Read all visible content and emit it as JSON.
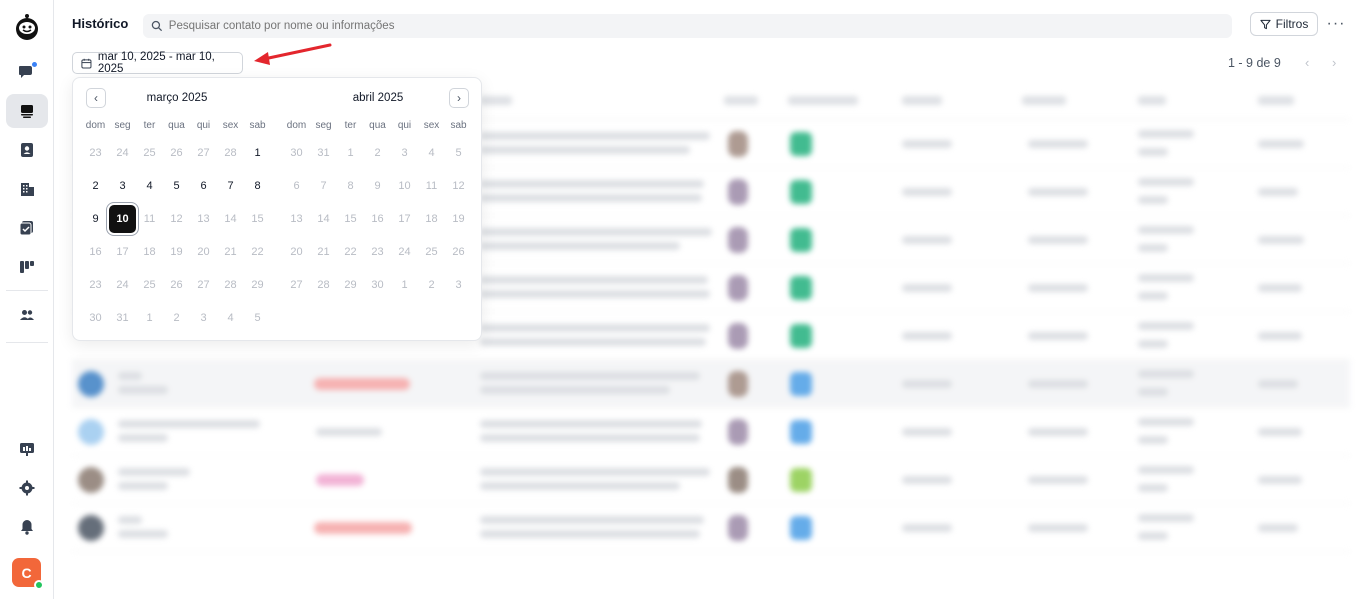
{
  "header": {
    "title": "Histórico",
    "search_placeholder": "Pesquisar contato por nome ou informações",
    "filters_label": "Filtros",
    "more_label": "···"
  },
  "date_range": {
    "label": "mar 10, 2025 - mar 10, 2025"
  },
  "pagination": {
    "text": "1 - 9 de 9",
    "prev": "‹",
    "next": "›"
  },
  "sidebar": {
    "avatar_initial": "C"
  },
  "calendar": {
    "prev": "‹",
    "next": "›",
    "weekdays": [
      "dom",
      "seg",
      "ter",
      "qua",
      "qui",
      "sex",
      "sab"
    ],
    "months": [
      {
        "title": "março 2025",
        "weeks": [
          [
            {
              "d": "23",
              "o": true
            },
            {
              "d": "24",
              "o": true
            },
            {
              "d": "25",
              "o": true
            },
            {
              "d": "26",
              "o": true
            },
            {
              "d": "27",
              "o": true
            },
            {
              "d": "28",
              "o": true
            },
            {
              "d": "1",
              "c": true
            }
          ],
          [
            {
              "d": "2",
              "c": true
            },
            {
              "d": "3",
              "c": true
            },
            {
              "d": "4",
              "c": true
            },
            {
              "d": "5",
              "c": true
            },
            {
              "d": "6",
              "c": true
            },
            {
              "d": "7",
              "c": true
            },
            {
              "d": "8",
              "c": true
            }
          ],
          [
            {
              "d": "9",
              "c": true
            },
            {
              "d": "10",
              "c": true,
              "s": true
            },
            {
              "d": "11"
            },
            {
              "d": "12"
            },
            {
              "d": "13"
            },
            {
              "d": "14"
            },
            {
              "d": "15"
            }
          ],
          [
            {
              "d": "16"
            },
            {
              "d": "17"
            },
            {
              "d": "18"
            },
            {
              "d": "19"
            },
            {
              "d": "20"
            },
            {
              "d": "21"
            },
            {
              "d": "22"
            }
          ],
          [
            {
              "d": "23"
            },
            {
              "d": "24"
            },
            {
              "d": "25"
            },
            {
              "d": "26"
            },
            {
              "d": "27"
            },
            {
              "d": "28"
            },
            {
              "d": "29"
            }
          ],
          [
            {
              "d": "30"
            },
            {
              "d": "31"
            },
            {
              "d": "1",
              "o": true
            },
            {
              "d": "2",
              "o": true
            },
            {
              "d": "3",
              "o": true
            },
            {
              "d": "4",
              "o": true
            },
            {
              "d": "5",
              "o": true
            }
          ]
        ]
      },
      {
        "title": "abril 2025",
        "weeks": [
          [
            {
              "d": "30",
              "o": true
            },
            {
              "d": "31",
              "o": true
            },
            {
              "d": "1"
            },
            {
              "d": "2"
            },
            {
              "d": "3"
            },
            {
              "d": "4"
            },
            {
              "d": "5"
            }
          ],
          [
            {
              "d": "6"
            },
            {
              "d": "7"
            },
            {
              "d": "8"
            },
            {
              "d": "9"
            },
            {
              "d": "10"
            },
            {
              "d": "11"
            },
            {
              "d": "12"
            }
          ],
          [
            {
              "d": "13"
            },
            {
              "d": "14"
            },
            {
              "d": "15"
            },
            {
              "d": "16"
            },
            {
              "d": "17"
            },
            {
              "d": "18"
            },
            {
              "d": "19"
            }
          ],
          [
            {
              "d": "20"
            },
            {
              "d": "21"
            },
            {
              "d": "22"
            },
            {
              "d": "23"
            },
            {
              "d": "24"
            },
            {
              "d": "25"
            },
            {
              "d": "26"
            }
          ],
          [
            {
              "d": "27"
            },
            {
              "d": "28"
            },
            {
              "d": "29"
            },
            {
              "d": "30"
            },
            {
              "d": "1",
              "o": true
            },
            {
              "d": "2",
              "o": true
            },
            {
              "d": "3",
              "o": true
            }
          ]
        ]
      }
    ]
  },
  "colors": {
    "selected_day": "#111111",
    "annotation_arrow": "#e3262d",
    "avatar_bg": "#f2673a",
    "status_dot": "#22c55e",
    "notify_dot": "#3b82f6"
  }
}
